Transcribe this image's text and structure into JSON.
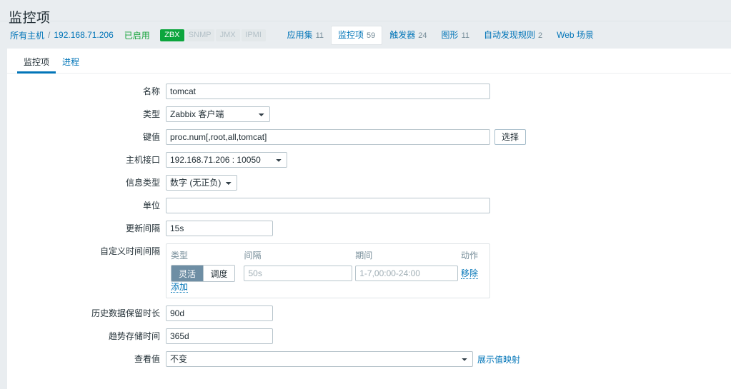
{
  "header": {
    "title": "监控项"
  },
  "breadcrumb": {
    "all_hosts": "所有主机",
    "separator": "/",
    "host": "192.168.71.206",
    "status": "已启用",
    "interfaces": [
      {
        "label": "ZBX",
        "enabled": true
      },
      {
        "label": "SNMP",
        "enabled": false
      },
      {
        "label": "JMX",
        "enabled": false
      },
      {
        "label": "IPMI",
        "enabled": false
      }
    ],
    "objects": [
      {
        "label": "应用集",
        "count": "11",
        "selected": false
      },
      {
        "label": "监控项",
        "count": "59",
        "selected": true
      },
      {
        "label": "触发器",
        "count": "24",
        "selected": false
      },
      {
        "label": "图形",
        "count": "11",
        "selected": false
      },
      {
        "label": "自动发现规则",
        "count": "2",
        "selected": false
      },
      {
        "label": "Web 场景",
        "count": "",
        "selected": false
      }
    ]
  },
  "subtabs": [
    {
      "label": "监控项",
      "active": true
    },
    {
      "label": "进程",
      "active": false
    }
  ],
  "form": {
    "name": {
      "label": "名称",
      "value": "tomcat"
    },
    "type": {
      "label": "类型",
      "value": "Zabbix 客户端"
    },
    "key": {
      "label": "键值",
      "value": "proc.num[,root,all,tomcat]",
      "select_button": "选择"
    },
    "host_interface": {
      "label": "主机接口",
      "value": "192.168.71.206 : 10050"
    },
    "info_type": {
      "label": "信息类型",
      "value": "数字 (无正负)"
    },
    "units": {
      "label": "单位",
      "value": ""
    },
    "update_interval": {
      "label": "更新间隔",
      "value": "15s"
    },
    "custom_intervals": {
      "label": "自定义时间间隔",
      "columns": {
        "type": "类型",
        "interval": "间隔",
        "period": "期间",
        "action": "动作"
      },
      "rows": [
        {
          "type_flexible": "灵活",
          "type_scheduling": "调度",
          "type_selected": "灵活",
          "interval_value": "",
          "interval_placeholder": "50s",
          "period_value": "",
          "period_placeholder": "1-7,00:00-24:00",
          "action": "移除"
        }
      ],
      "add_label": "添加"
    },
    "history": {
      "label": "历史数据保留时长",
      "value": "90d"
    },
    "trends": {
      "label": "趋势存储时间",
      "value": "365d"
    },
    "value_mapping": {
      "label": "查看值",
      "value": "不变",
      "link": "展示值映射"
    }
  },
  "colors": {
    "accent_link": "#0275b8",
    "enabled_green": "#15a43a",
    "badge_green": "#0ca53d",
    "page_bg": "#e9edf0",
    "toggle_on": "#6e8ea4"
  }
}
